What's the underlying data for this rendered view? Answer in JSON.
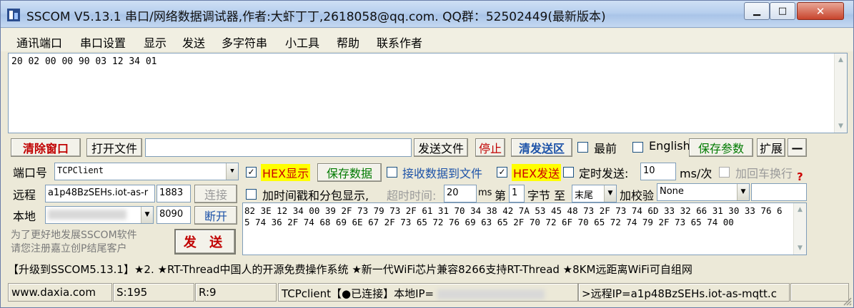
{
  "window": {
    "title": "SSCOM V5.13.1 串口/网络数据调试器,作者:大虾丁丁,2618058@qq.com. QQ群：52502449(最新版本)",
    "minimize_icon": "minimize-icon",
    "maximize_icon": "maximize-icon",
    "close_icon": "close-icon"
  },
  "menu": [
    "通讯端口",
    "串口设置",
    "显示",
    "发送",
    "多字符串",
    "小工具",
    "帮助",
    "联系作者"
  ],
  "receive": {
    "text": "20 02 00 00 90 03 12 34 01"
  },
  "toolbar": {
    "clear_label": "清除窗口",
    "open_file_label": "打开文件",
    "file_path": "",
    "send_file_label": "发送文件",
    "stop_label": "停止",
    "clear_send_label": "清发送区",
    "topmost_label": "最前",
    "english_label": "English",
    "save_params_label": "保存参数",
    "expand_label": "扩展",
    "collapse_label": "—"
  },
  "conn": {
    "port_label": "端口号",
    "port_value": "TCPClient",
    "remote_label": "远程",
    "remote_host": "a1p48BzSEHs.iot-as-r",
    "remote_port": "1883",
    "connect_label": "连接",
    "local_label": "本地",
    "local_port": "8090",
    "disconnect_label": "断开"
  },
  "opts": {
    "hex_display_label": "HEX显示",
    "hex_display_checked": true,
    "save_data_label": "保存数据",
    "recv_to_file_label": "接收数据到文件",
    "hex_send_label": "HEX发送",
    "hex_send_checked": true,
    "timed_send_label": "定时发送:",
    "timed_value": "10",
    "timed_unit": "ms/次",
    "newline_label": "加回车换行",
    "timestamp_label": "加时间戳和分包显示,",
    "timeout_label": "超时时间:",
    "timeout_value": "20",
    "timeout_unit": "ms",
    "byte_prefix": "第",
    "byte_value": "1",
    "byte_suffix": "字节 至",
    "byte_end": "末尾",
    "checksum_label": "加校验",
    "checksum_value": "None",
    "help_icon": "question-icon"
  },
  "promo_left": "为了更好地发展SSCOM软件\n请您注册嘉立创P结尾客户",
  "send_button_label": "发 送",
  "send_text": "82 3E 12 34 00 39 2F 73 79 73 2F 61 31 70 34 38 42 7A 53 45 48 73 2F 73 74 6D 33 32 66 31 30 33 76 65 74 36 2F 74 68 69 6E 67 2F 73 65 72 76 69 63 65 2F 70 72 6F 70 65 72 74 79 2F 73 65 74 00",
  "promo_banner": "【升级到SSCOM5.13.1】★2. ★RT-Thread中国人的开源免费操作系统 ★新一代WiFi芯片兼容8266支持RT-Thread ★8KM远距离WiFi可自组网",
  "status": {
    "site": "www.daxia.com",
    "sent": "S:195",
    "recv": "R:9",
    "conn_prefix": "TCPclient【●已连接】本地IP=",
    "remote": ">远程IP=a1p48BzSEHs.iot-as-mqtt.c"
  }
}
